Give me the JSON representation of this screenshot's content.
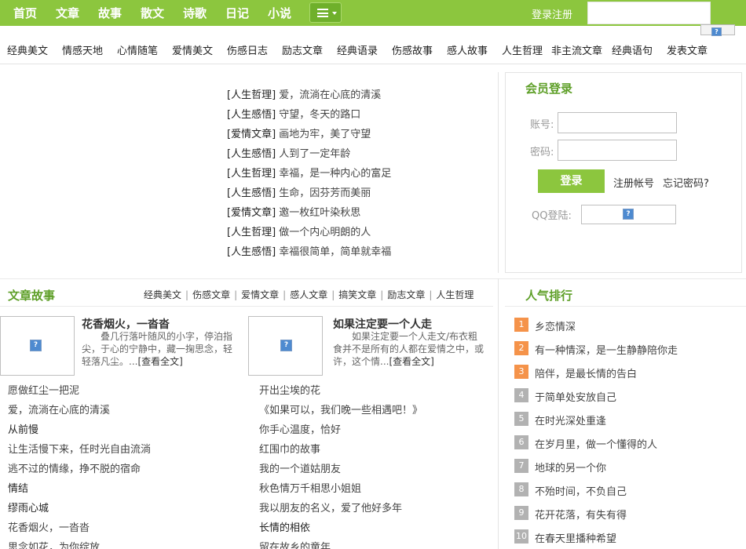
{
  "topnav": {
    "links": [
      "首页",
      "文章",
      "故事",
      "散文",
      "诗歌",
      "日记",
      "小说"
    ],
    "login_register": "登录注册",
    "search_placeholder": ""
  },
  "categories": [
    "经典美文",
    "情感天地",
    "心情随笔",
    "爱情美文",
    "伤感日志",
    "励志文章",
    "经典语录",
    "伤感故事",
    "感人故事",
    "人生哲理",
    "非主流文章",
    "经典语句",
    "发表文章"
  ],
  "headlines": [
    {
      "tag": "[人生哲理]",
      "title": "爱，流淌在心底的清溪"
    },
    {
      "tag": "[人生感悟]",
      "title": "守望，冬天的路口"
    },
    {
      "tag": "[爱情文章]",
      "title": "画地为牢，美了守望"
    },
    {
      "tag": "[人生感悟]",
      "title": "人到了一定年龄"
    },
    {
      "tag": "[人生哲理]",
      "title": "幸福，是一种内心的富足"
    },
    {
      "tag": "[人生感悟]",
      "title": "生命，因芬芳而美丽"
    },
    {
      "tag": "[爱情文章]",
      "title": "邀一枚红叶染秋思"
    },
    {
      "tag": "[人生哲理]",
      "title": "做一个内心明朗的人"
    },
    {
      "tag": "[人生感悟]",
      "title": "幸福很简单，简单就幸福"
    }
  ],
  "login": {
    "title": "会员登录",
    "account_label": "账号:",
    "password_label": "密码:",
    "login_button": "登录",
    "register_link": "注册帐号",
    "forgot_link": "忘记密码?",
    "qq_label": "QQ登陆:"
  },
  "stories": {
    "title": "文章故事",
    "subnav": [
      "经典美文",
      "伤感文章",
      "爱情文章",
      "感人文章",
      "搞笑文章",
      "励志文章",
      "人生哲理"
    ],
    "featured": [
      {
        "title": "花香烟火，一沓沓",
        "desc": "叠几行落叶随风的小字，停泊指尖，于心的宁静中，藏一掬思念，轻轻落凡尘。...",
        "more": "[查看全文]"
      },
      {
        "title": "如果注定要一个人走",
        "desc": "如果注定要一个人走文/布衣粗食并不是所有的人都在爱情之中，或许，这个情...",
        "more": "[查看全文]"
      }
    ],
    "left_list": [
      "愿做红尘一把泥",
      "爱，流淌在心底的清溪",
      "从前慢",
      "让生活慢下来，任时光自由流淌",
      "逃不过的情缘，挣不脱的宿命",
      "情结",
      "缪雨心城",
      "花香烟火，一沓沓",
      "思念如花，为你绽放"
    ],
    "right_list": [
      "开出尘埃的花",
      "《如果可以，我们晚一些相遇吧！》",
      "你手心温度，恰好",
      "红围巾的故事",
      "我的一个道姑朋友",
      "秋色情万千相思小姐姐",
      "我以朋友的名义，爱了他好多年",
      "长情的相依",
      "留在故乡的童年"
    ]
  },
  "ranking": {
    "title": "人气排行",
    "items": [
      {
        "num": "1",
        "title": "乡恋情深"
      },
      {
        "num": "2",
        "title": "有一种情深，是一生静静陪你走"
      },
      {
        "num": "3",
        "title": "陪伴，是最长情的告白"
      },
      {
        "num": "4",
        "title": "于简单处安放自己"
      },
      {
        "num": "5",
        "title": "在时光深处重逢"
      },
      {
        "num": "6",
        "title": "在岁月里，做一个懂得的人"
      },
      {
        "num": "7",
        "title": "地球的另一个你"
      },
      {
        "num": "8",
        "title": "不殆时间，不负自己"
      },
      {
        "num": "9",
        "title": "花开花落，有失有得"
      },
      {
        "num": "10",
        "title": "在春天里播种希望"
      }
    ]
  },
  "colors": {
    "brand_green": "#8cc63e",
    "title_green": "#5e9f28",
    "rank_hot": "#f5934a",
    "rank_normal": "#b2b2b2"
  },
  "icons": {
    "menu": "list-menu-icon",
    "broken_image": "broken-image-icon"
  }
}
